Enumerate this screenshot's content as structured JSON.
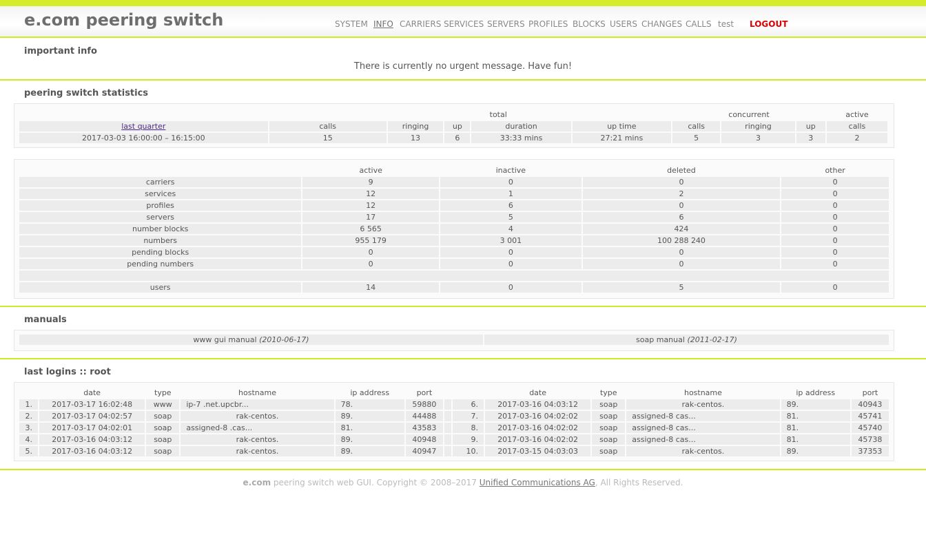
{
  "header": {
    "brand": "e.com peering switch",
    "nav": [
      "SYSTEM",
      "INFO",
      "CARRIERS",
      "SERVICES",
      "SERVERS",
      "PROFILES",
      "BLOCKS",
      "USERS",
      "CHANGES",
      "CALLS",
      "test"
    ],
    "logout": "LOGOUT",
    "active_tab": "INFO",
    "accent_color": "#ccee1e",
    "logout_color": "#dd0000"
  },
  "important": {
    "title": "important info",
    "message": "There is currently no urgent message. Have fun!"
  },
  "stats": {
    "title": "peering switch statistics",
    "group_total": "total",
    "group_concurrent": "concurrent",
    "group_active": "active",
    "period_link": "last quarter",
    "columns": [
      "calls",
      "ringing",
      "up",
      "duration",
      "up time",
      "calls",
      "ringing",
      "up",
      "calls"
    ],
    "period_range": "2017-03-03 16:00:00 – 16:15:00",
    "values": [
      "15",
      "13",
      "6",
      "33:33 mins",
      "27:21 mins",
      "5",
      "3",
      "3",
      "2"
    ]
  },
  "objects": {
    "columns": [
      "active",
      "inactive",
      "deleted",
      "other"
    ],
    "rows": [
      {
        "name": "carriers",
        "values": [
          "9",
          "0",
          "0",
          "0"
        ]
      },
      {
        "name": "services",
        "values": [
          "12",
          "1",
          "2",
          "0"
        ]
      },
      {
        "name": "profiles",
        "values": [
          "12",
          "6",
          "0",
          "0"
        ]
      },
      {
        "name": "servers",
        "values": [
          "17",
          "5",
          "6",
          "0"
        ]
      },
      {
        "name": "number blocks",
        "values": [
          "6 565",
          "4",
          "424",
          "0"
        ]
      },
      {
        "name": "numbers",
        "values": [
          "955 179",
          "3 001",
          "100 288 240",
          "0"
        ]
      },
      {
        "name": "pending blocks",
        "values": [
          "0",
          "0",
          "0",
          "0"
        ]
      },
      {
        "name": "pending numbers",
        "values": [
          "0",
          "0",
          "0",
          "0"
        ]
      },
      {
        "name": "users",
        "values": [
          "14",
          "0",
          "5",
          "0"
        ]
      }
    ]
  },
  "manuals": {
    "title": "manuals",
    "www_label": "www gui manual",
    "www_date": "(2010-06-17)",
    "soap_label": "soap manual",
    "soap_date": "(2011-02-17)"
  },
  "logins": {
    "title": "last logins :: root",
    "columns": [
      "date",
      "type",
      "hostname",
      "ip address",
      "port"
    ],
    "left": [
      {
        "n": "1.",
        "date": "2017-03-17 16:02:48",
        "type": "www",
        "host": "ip-7                    .net.upcbr...",
        "ip": "78.",
        "port": "59880"
      },
      {
        "n": "2.",
        "date": "2017-03-17 04:02:57",
        "type": "soap",
        "host": "rak-centos.",
        "ip": "89.",
        "port": "44488"
      },
      {
        "n": "3.",
        "date": "2017-03-17 04:02:01",
        "type": "soap",
        "host": "assigned-8                    .cas...",
        "ip": "81.",
        "port": "43583"
      },
      {
        "n": "4.",
        "date": "2017-03-16 04:03:12",
        "type": "soap",
        "host": "rak-centos.",
        "ip": "89.",
        "port": "40948"
      },
      {
        "n": "5.",
        "date": "2017-03-16 04:03:12",
        "type": "soap",
        "host": "rak-centos.",
        "ip": "89.",
        "port": "40947"
      }
    ],
    "right": [
      {
        "n": "6.",
        "date": "2017-03-16 04:03:12",
        "type": "soap",
        "host": "rak-centos.",
        "ip": "89.",
        "port": "40943"
      },
      {
        "n": "7.",
        "date": "2017-03-16 04:02:02",
        "type": "soap",
        "host": "assigned-8                    cas...",
        "ip": "81.",
        "port": "45741"
      },
      {
        "n": "8.",
        "date": "2017-03-16 04:02:02",
        "type": "soap",
        "host": "assigned-8                    cas...",
        "ip": "81.",
        "port": "45740"
      },
      {
        "n": "9.",
        "date": "2017-03-16 04:02:02",
        "type": "soap",
        "host": "assigned-8                    cas...",
        "ip": "81.",
        "port": "45738"
      },
      {
        "n": "10.",
        "date": "2017-03-15 04:03:03",
        "type": "soap",
        "host": "rak-centos.",
        "ip": "89.",
        "port": "37353"
      }
    ]
  },
  "footer": {
    "brand": "e.com",
    "text": " peering switch web GUI. Copyright © 2008–2017 ",
    "company": "Unified Communications AG",
    "rights": ", All Rights Reserved."
  }
}
